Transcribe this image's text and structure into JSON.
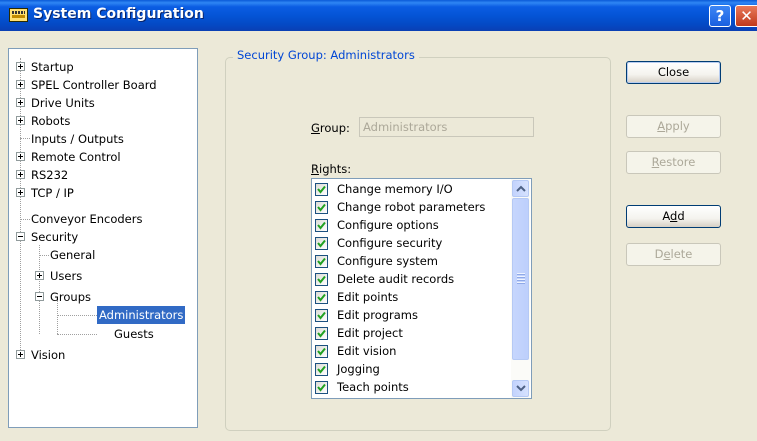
{
  "window": {
    "title": "System Configuration",
    "help_glyph": "?",
    "close_glyph": "✕"
  },
  "tree": {
    "items": [
      {
        "label": "Startup",
        "expander": "plus"
      },
      {
        "label": "SPEL Controller Board",
        "expander": "plus"
      },
      {
        "label": "Drive Units",
        "expander": "plus"
      },
      {
        "label": "Robots",
        "expander": "plus"
      },
      {
        "label": "Inputs / Outputs",
        "expander": "none"
      },
      {
        "label": "Remote Control",
        "expander": "plus"
      },
      {
        "label": "RS232",
        "expander": "plus"
      },
      {
        "label": "TCP / IP",
        "expander": "plus"
      },
      {
        "label": "Conveyor Encoders",
        "expander": "none"
      },
      {
        "label": "Security",
        "expander": "minus"
      },
      {
        "label": "General",
        "expander": "none"
      },
      {
        "label": "Users",
        "expander": "plus"
      },
      {
        "label": "Groups",
        "expander": "minus"
      },
      {
        "label": "Administrators",
        "expander": "none",
        "selected": true
      },
      {
        "label": "Guests",
        "expander": "none"
      },
      {
        "label": "Vision",
        "expander": "plus"
      }
    ]
  },
  "security_group": {
    "title": "Security Group: Administrators",
    "group_label": "Group:",
    "group_label_accel": "G",
    "group_label_rest": "roup:",
    "group_value": "Administrators",
    "rights_label_accel": "R",
    "rights_label_rest": "ights:",
    "rights": [
      {
        "label": "Change memory I/O",
        "checked": true
      },
      {
        "label": "Change robot parameters",
        "checked": true
      },
      {
        "label": "Configure options",
        "checked": true
      },
      {
        "label": "Configure security",
        "checked": true
      },
      {
        "label": "Configure system",
        "checked": true
      },
      {
        "label": "Delete audit records",
        "checked": true
      },
      {
        "label": "Edit points",
        "checked": true
      },
      {
        "label": "Edit programs",
        "checked": true
      },
      {
        "label": "Edit project",
        "checked": true
      },
      {
        "label": "Edit vision",
        "checked": true
      },
      {
        "label": "Jogging",
        "checked": true
      },
      {
        "label": "Teach points",
        "checked": true
      }
    ]
  },
  "buttons": {
    "close": "Close",
    "apply_accel": "A",
    "apply_rest": "pply",
    "restore_accel": "R",
    "restore_rest": "estore",
    "add_pre": "A",
    "add_accel": "d",
    "add_rest": "d",
    "delete_pre": "D",
    "delete_accel": "e",
    "delete_rest": "lete"
  },
  "colors": {
    "titlebar": "#0454d6",
    "selection": "#316ac5",
    "checkmark": "#21a121",
    "group_title": "#0046d5",
    "disabled_text": "#aca899"
  }
}
